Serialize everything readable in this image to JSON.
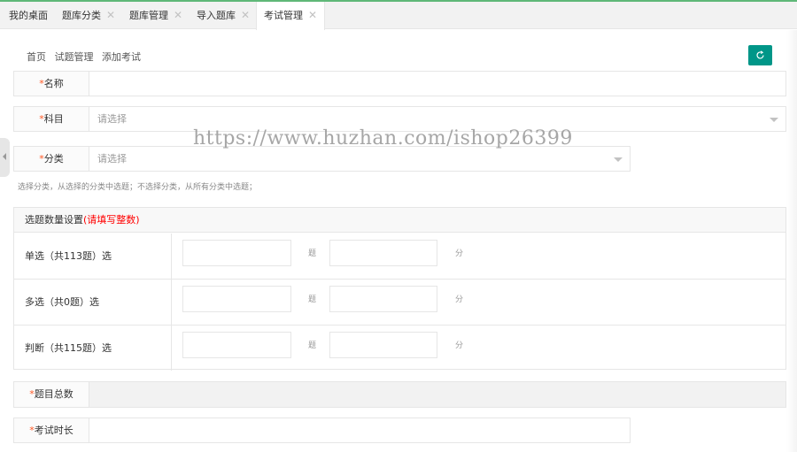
{
  "tabs": [
    {
      "label": "我的桌面",
      "closable": false
    },
    {
      "label": "题库分类",
      "closable": true
    },
    {
      "label": "题库管理",
      "closable": true
    },
    {
      "label": "导入题库",
      "closable": true
    },
    {
      "label": "考试管理",
      "closable": true,
      "active": true
    }
  ],
  "close_glyph": "✕",
  "breadcrumb": [
    "首页",
    "试题管理",
    "添加考试"
  ],
  "form": {
    "required_mark": "*",
    "name_label": "名称",
    "subject_label": "科目",
    "subject_placeholder": "请选择",
    "category_label": "分类",
    "category_placeholder": "请选择",
    "category_hint": "选择分类，从选择的分类中选题；不选择分类，从所有分类中选题；",
    "total_label": "题目总数",
    "duration_label": "考试时长"
  },
  "question_settings": {
    "title": "选题数量设置",
    "title_note": "(请填写整数)",
    "rows": [
      {
        "label": "单选（共113题）选",
        "count_unit": "题",
        "score_unit": "分"
      },
      {
        "label": "多选（共0题）选",
        "count_unit": "题",
        "score_unit": "分"
      },
      {
        "label": "判断（共115题）选",
        "count_unit": "题",
        "score_unit": "分"
      }
    ]
  },
  "watermark_text": "https://www.huzhan.com/ishop26399",
  "colors": {
    "accent": "#009688",
    "tab_top": "#5fb878",
    "required": "#ff5722",
    "note_red": "#ff0000"
  }
}
